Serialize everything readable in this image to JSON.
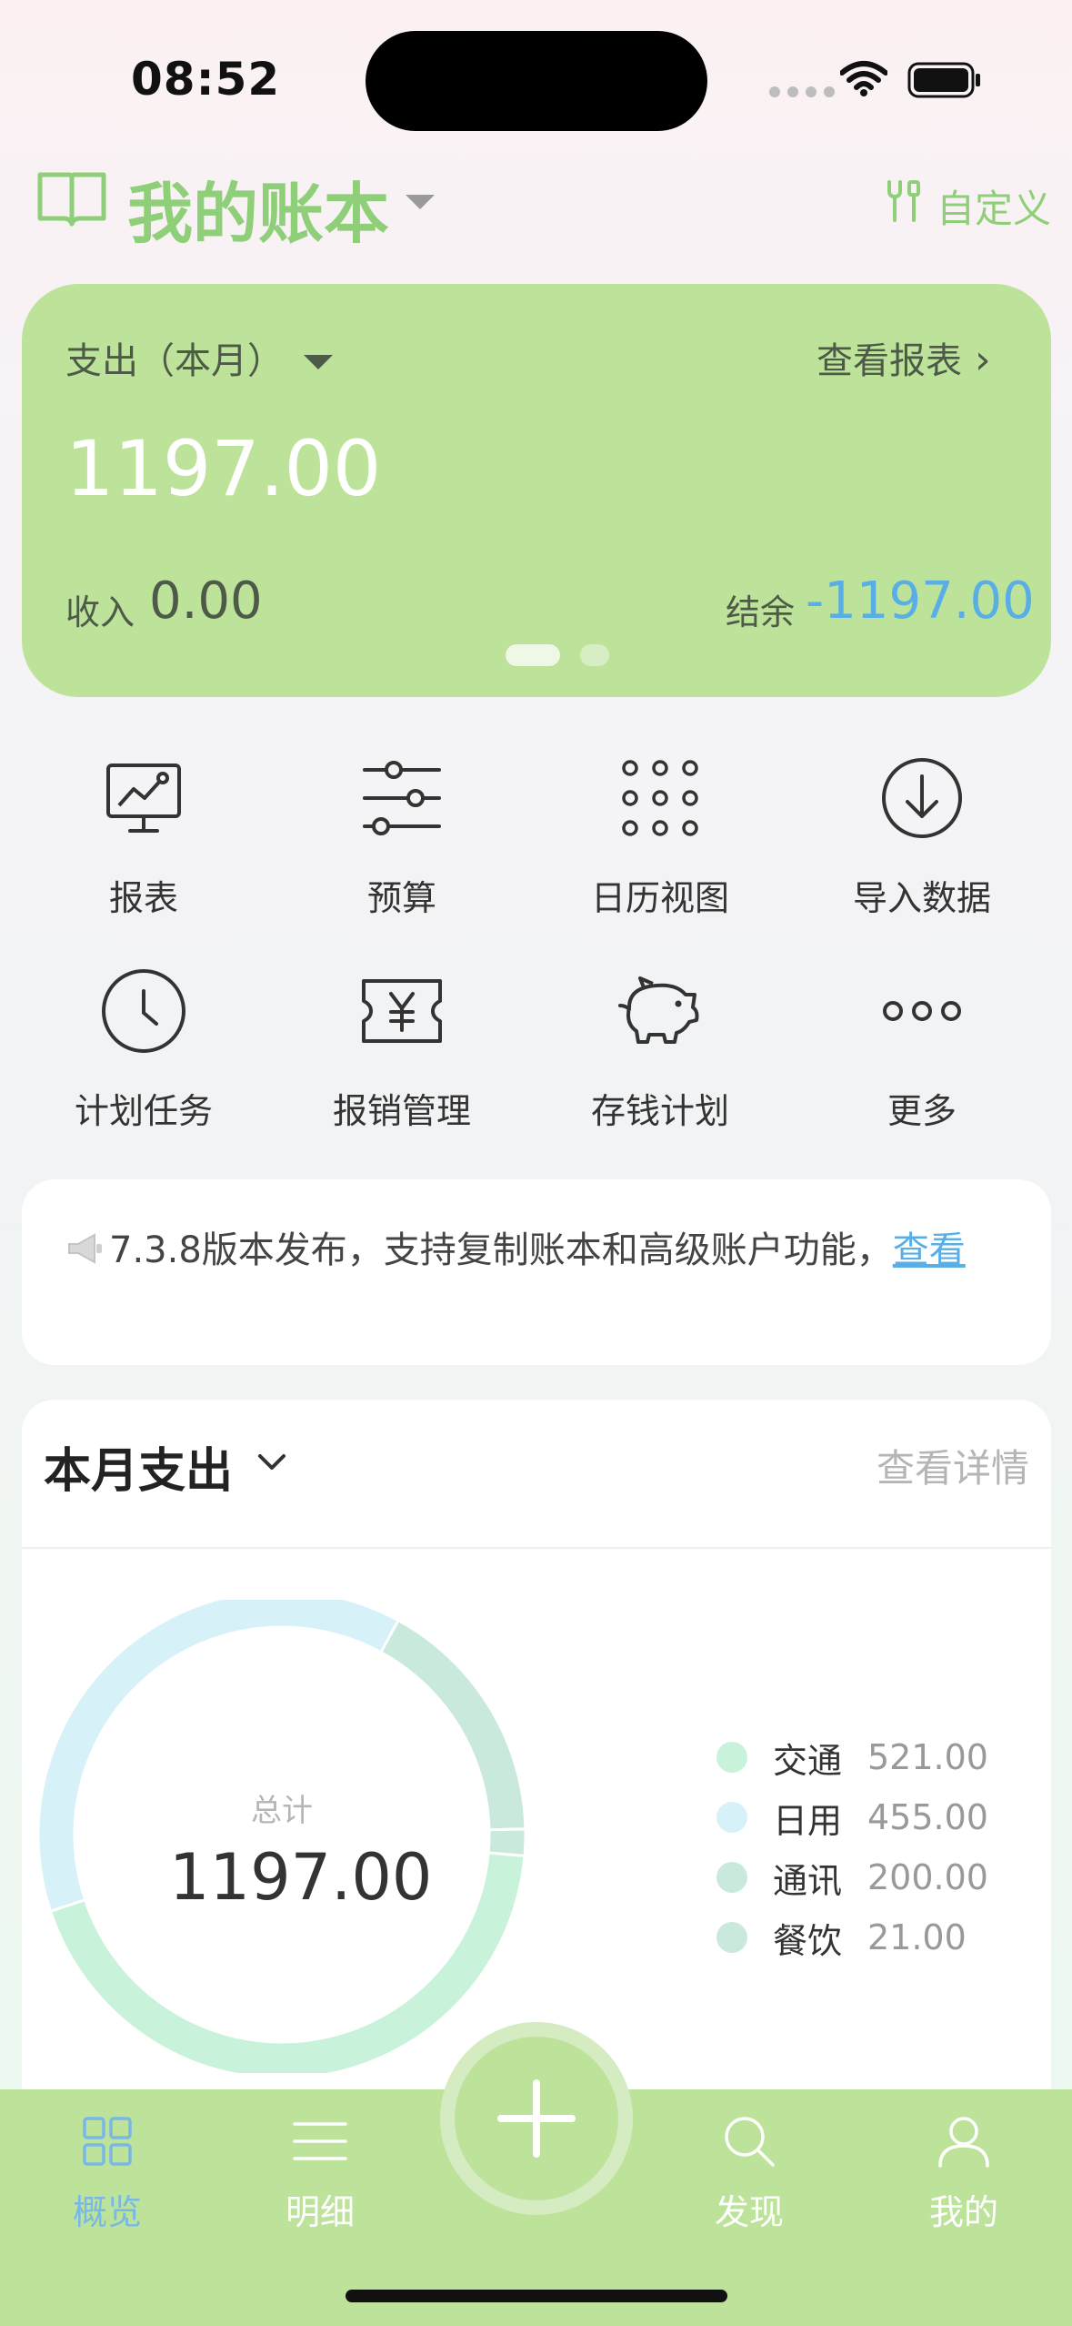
{
  "status_bar": {
    "time": "08:52"
  },
  "header": {
    "title": "我的账本",
    "customize_label": "自定义"
  },
  "summary": {
    "expense_label": "支出（本月）",
    "report_link": "查看报表",
    "expense_amount": "1197.00",
    "income_label": "收入",
    "income_amount": "0.00",
    "balance_label": "结余",
    "balance_amount": "-1197.00"
  },
  "quick_actions": [
    {
      "label": "报表",
      "icon": "report-chart-icon"
    },
    {
      "label": "预算",
      "icon": "sliders-icon"
    },
    {
      "label": "日历视图",
      "icon": "dot-grid-icon"
    },
    {
      "label": "导入数据",
      "icon": "download-circle-icon"
    },
    {
      "label": "计划任务",
      "icon": "clock-icon"
    },
    {
      "label": "报销管理",
      "icon": "yen-ticket-icon"
    },
    {
      "label": "存钱计划",
      "icon": "piggy-bank-icon"
    },
    {
      "label": "更多",
      "icon": "more-dots-icon"
    }
  ],
  "notice": {
    "text": "7.3.8版本发布，支持复制账本和高级账户功能，",
    "link": "查看"
  },
  "monthly_expense": {
    "title": "本月支出",
    "detail_link": "查看详情",
    "total_label": "总计",
    "total_amount": "1197.00"
  },
  "chart_data": {
    "type": "pie",
    "title": "本月支出",
    "categories": [
      "交通",
      "日用",
      "通讯",
      "餐饮"
    ],
    "values": [
      521.0,
      455.0,
      200.0,
      21.0
    ],
    "value_labels": [
      "521.00",
      "455.00",
      "200.00",
      "21.00"
    ],
    "colors": [
      "#c8f2d9",
      "#d6f1f7",
      "#c9e9dc",
      "#c9e9dc"
    ],
    "total": 1197.0,
    "legend": "right"
  },
  "tabs": [
    {
      "label": "概览",
      "icon": "grid-four-icon",
      "active": true
    },
    {
      "label": "明细",
      "icon": "list-lines-icon",
      "active": false
    },
    {
      "label": "发现",
      "icon": "search-icon",
      "active": false
    },
    {
      "label": "我的",
      "icon": "user-icon",
      "active": false
    }
  ],
  "colors": {
    "accent_green": "#bde39a",
    "title_green": "#8fcf79",
    "link_blue": "#5aaee6"
  }
}
